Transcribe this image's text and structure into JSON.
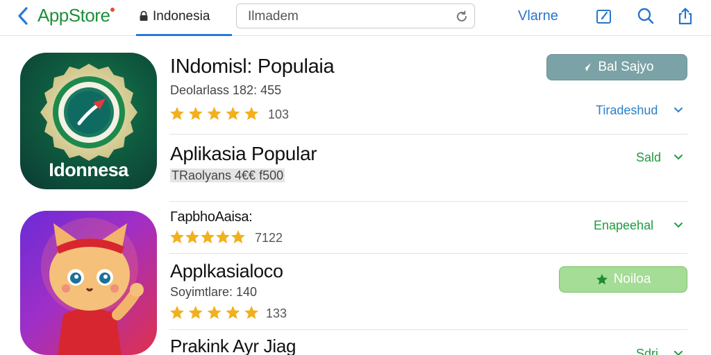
{
  "header": {
    "back_label": "AppStore",
    "location_tab": "Indonesia",
    "search_value": "Ilmadem",
    "account_name": "Vlarne"
  },
  "icons": {
    "app1_caption": "Idonnesa"
  },
  "rows": [
    {
      "title": "INdomisl: Populaia",
      "subtitle": "Deolarlass 182: 455",
      "rating": 5,
      "count": "103",
      "button": "Bal Sajyo",
      "status": "Tiradeshud"
    },
    {
      "title": "Aplikasia Popular",
      "subtitle": "TRaolyans 4€€ f500",
      "status": "Sald"
    },
    {
      "title": "ГapbhoAaisa:",
      "rating": 5,
      "count": "7122",
      "status": "Enapeehal"
    },
    {
      "title": "Applkasialoco",
      "subtitle": "Soyimtlare: 140",
      "rating": 5,
      "count": "133",
      "button": "Noiloa"
    },
    {
      "title": "Prakink Ayr Jiag",
      "status": "Sdri"
    }
  ],
  "colors": {
    "accent_blue": "#2a7ad6",
    "brand_green": "#1f8f3a",
    "status_green": "#1e9a3f",
    "status_blue": "#2a80c8",
    "star_gold": "#f2b01e",
    "button_gray": "#7ba2a6",
    "button_green": "#a5dc96"
  },
  "icon_names": [
    "back-chevron-icon",
    "lock-icon",
    "reload-icon",
    "edit-icon",
    "search-icon",
    "share-icon",
    "compass-icon",
    "star-icon",
    "chevron-down-icon",
    "send-icon"
  ]
}
